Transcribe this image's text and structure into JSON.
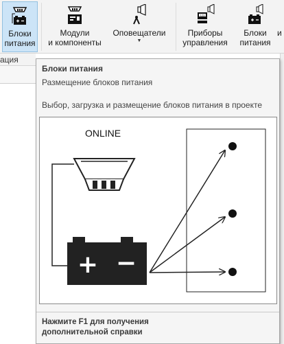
{
  "ribbon": {
    "buttons": [
      {
        "id": "power",
        "line1": "Блоки",
        "line2": "питания",
        "icon": "power-supply-icon",
        "active": true
      },
      {
        "id": "modules",
        "line1": "Модули",
        "line2": "и компоненты",
        "icon": "module-icon"
      },
      {
        "id": "alerts",
        "line1": "Оповещатели",
        "line2": "",
        "icon": "siren-icon",
        "dropdown": true
      },
      {
        "id": "control",
        "line1": "Приборы",
        "line2": "управления",
        "icon": "control-device-icon"
      },
      {
        "id": "power2",
        "line1": "Блоки",
        "line2": "питания",
        "icon": "power-supply-icon"
      },
      {
        "id": "more",
        "line1": "и",
        "line2": "",
        "icon": ""
      }
    ]
  },
  "left_strip": {
    "text": "ация"
  },
  "tooltip": {
    "title": "Блоки питания",
    "subtitle": "Размещение блоков питания",
    "description": "Выбор, загрузка и размещение блоков питания в проекте",
    "image": {
      "label": "ONLINE",
      "battery_plus": "+",
      "battery_minus": "−"
    },
    "help_line1": "Нажмите F1 для получения",
    "help_line2": "дополнительной справки"
  },
  "colors": {
    "ribbon_bg": "#f3f3f3",
    "active_bg": "#cce4f7",
    "active_border": "#92c0e0",
    "tooltip_bg": "#f5f5f5",
    "diagram_dark": "#222222"
  }
}
